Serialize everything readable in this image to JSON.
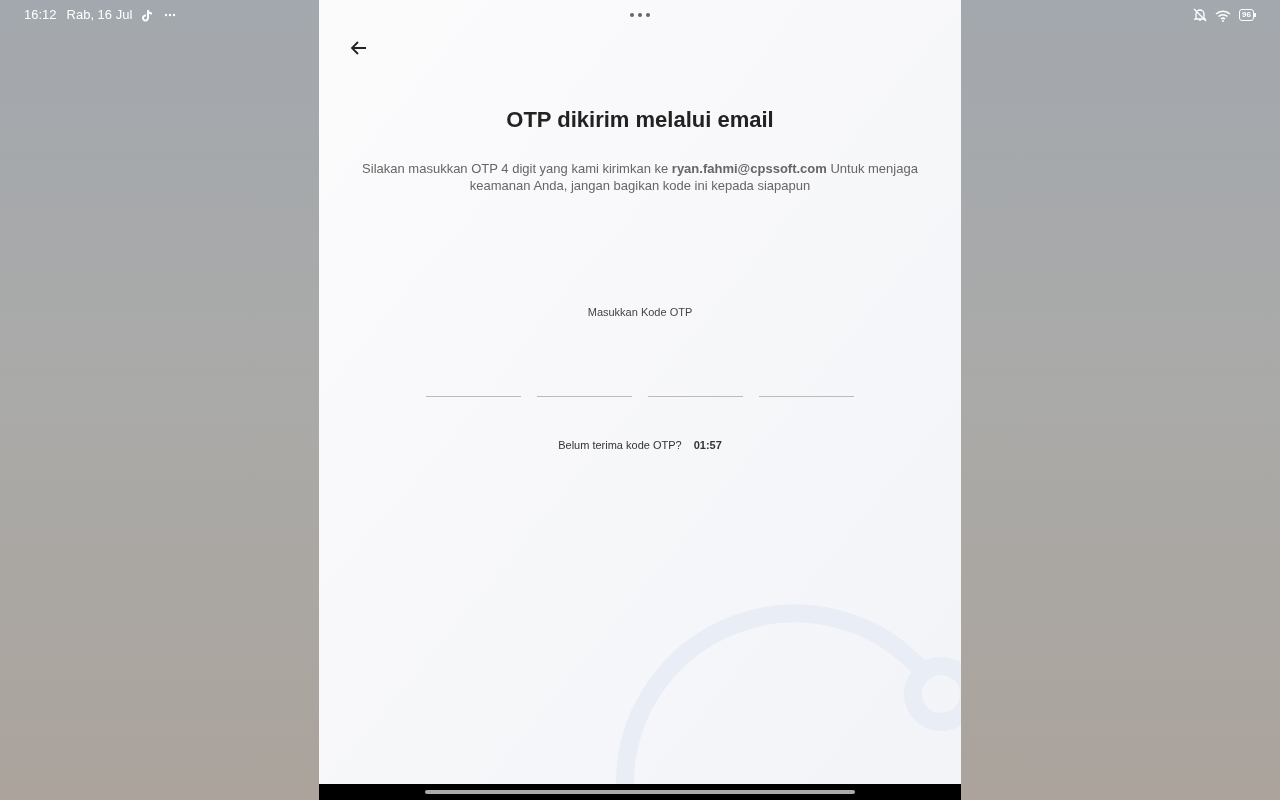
{
  "status_bar": {
    "time": "16:12",
    "date": "Rab, 16 Jul",
    "battery": "96"
  },
  "screen": {
    "title": "OTP dikirim melalui email",
    "description": "Silakan masukkan OTP 4 digit yang kami kirimkan ke **ryan.fahmi@cpssoft.com** Untuk menjaga keamanan Anda, jangan bagikan kode ini kepada siapapun",
    "otp_label": "Masukkan Kode OTP",
    "otp_fields": [
      {
        "focused": false
      },
      {
        "focused": false
      },
      {
        "focused": false
      },
      {
        "focused": false
      }
    ],
    "resend_prompt": "Belum terima kode OTP?",
    "countdown": "01:57"
  }
}
